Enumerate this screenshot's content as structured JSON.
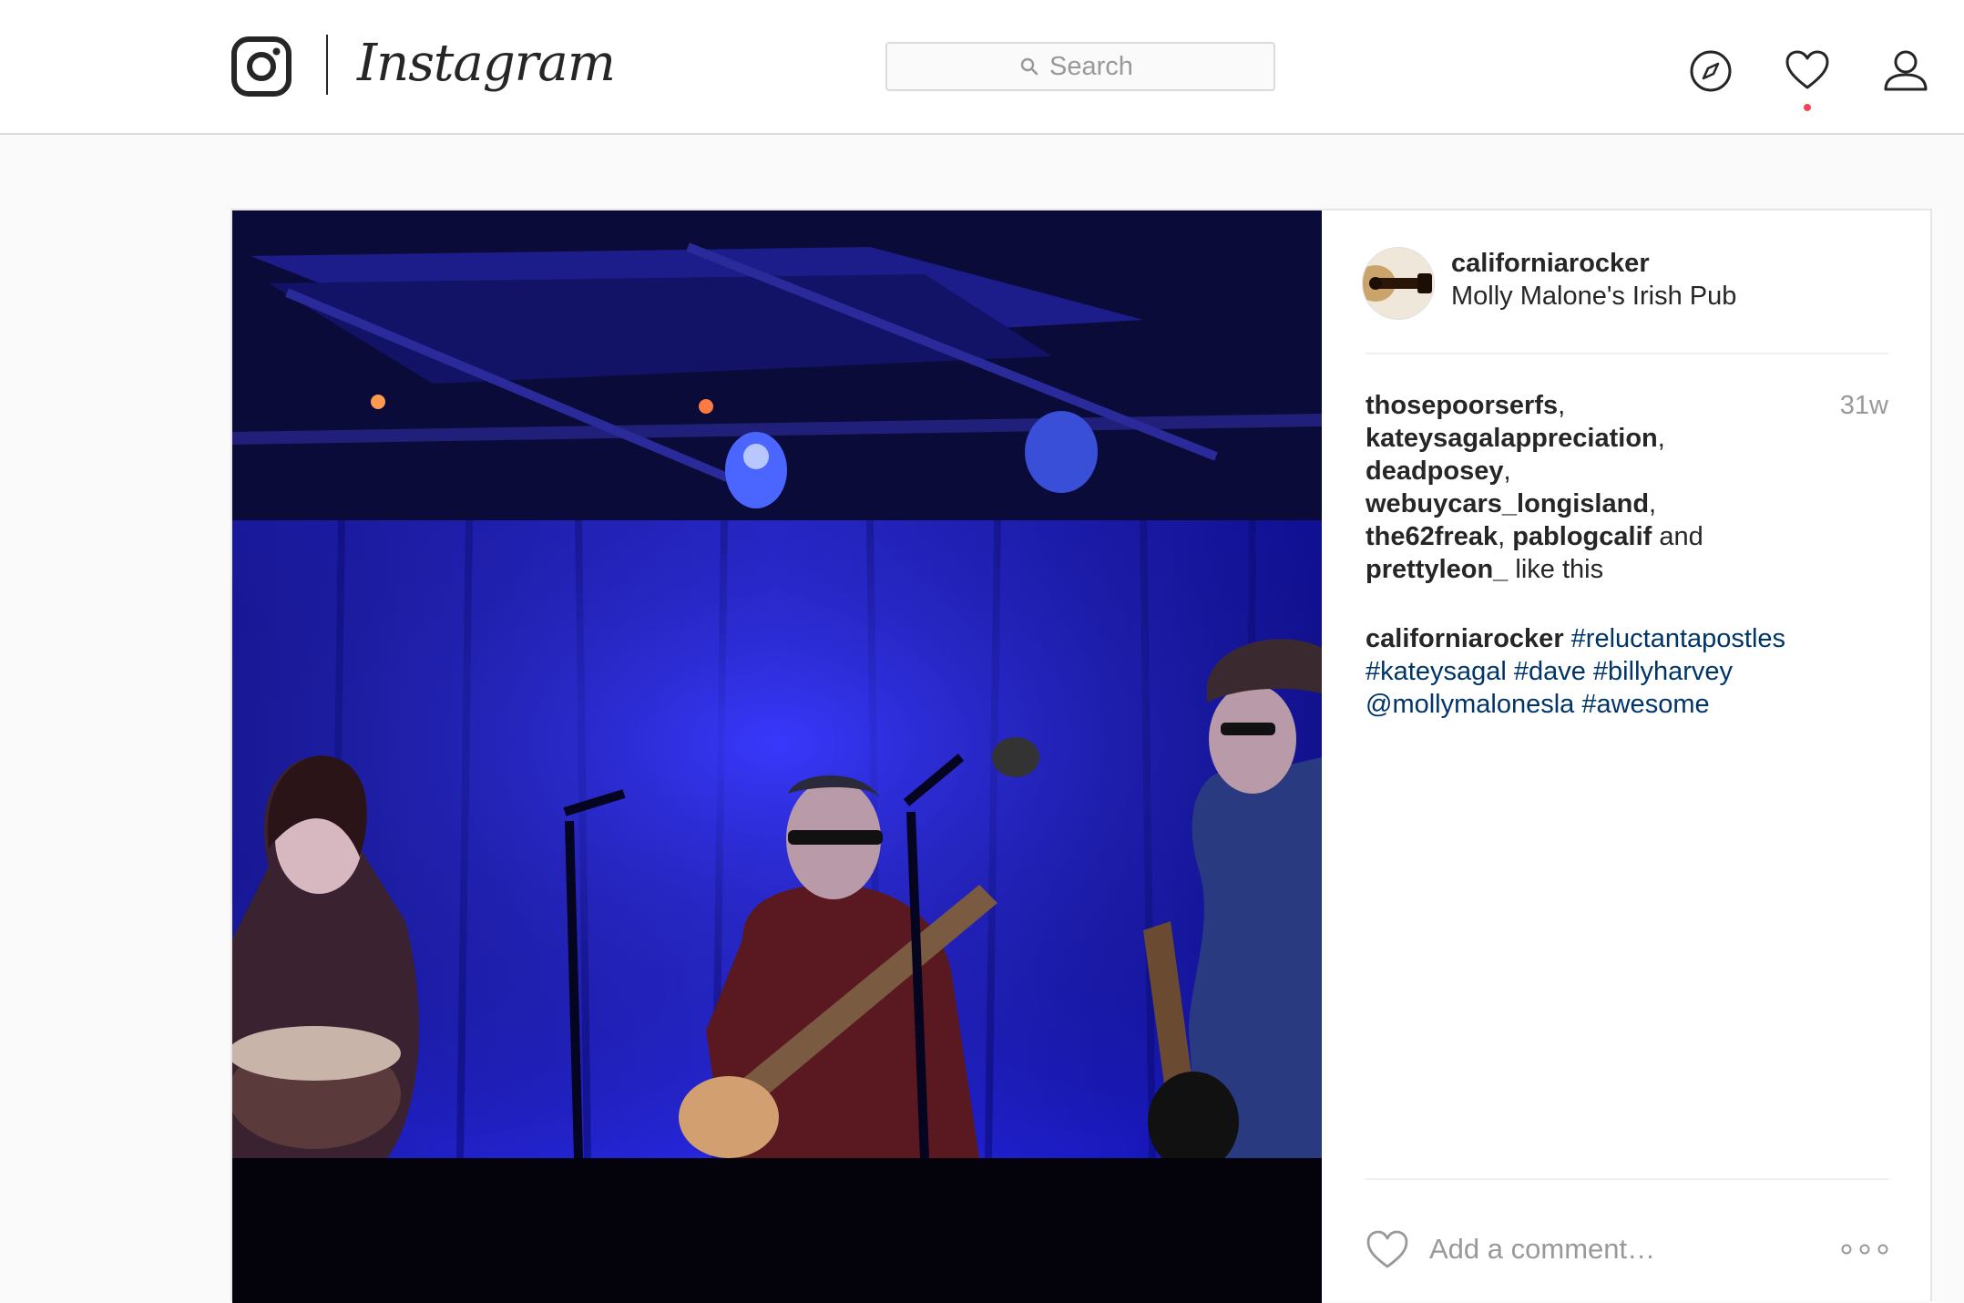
{
  "brand": {
    "wordmark": "Instagram"
  },
  "search": {
    "placeholder": "Search"
  },
  "nav": {
    "icons": [
      "compass-icon",
      "heart-icon",
      "person-icon"
    ],
    "notification": true
  },
  "post": {
    "author": "californiarocker",
    "location": "Molly Malone's Irish Pub",
    "time_ago": "31w",
    "likes": {
      "users": [
        "thosepoorserfs",
        "kateysagalappreciation",
        "deadposey",
        "webuycars_longisland",
        "the62freak",
        "pablogcalif",
        "prettyleon_"
      ],
      "and_text": "and",
      "suffix": "like this"
    },
    "caption": {
      "author": "californiarocker",
      "tags": [
        "#reluctantapostles",
        "#kateysagal",
        "#dave",
        "#billyharvey",
        "@mollymalonesla",
        "#awesome"
      ]
    },
    "comment_placeholder": "Add a comment…"
  },
  "colors": {
    "link": "#003569",
    "muted": "#999999",
    "notification_dot": "#ed4956",
    "border": "#dbdbdb"
  }
}
